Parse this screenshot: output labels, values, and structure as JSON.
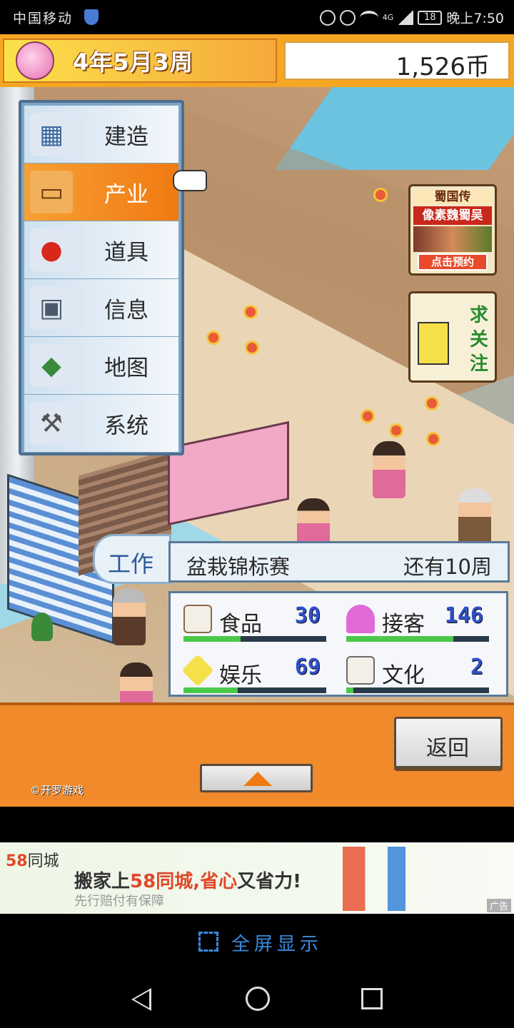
{
  "status_bar": {
    "carrier": "中国移动",
    "network": "4G",
    "battery": "18",
    "time": "晚上7:50"
  },
  "header": {
    "date": "4年5月3周",
    "money": "1,526币"
  },
  "menu": {
    "items": [
      {
        "label": "建造",
        "icon": "building-icon"
      },
      {
        "label": "产业",
        "icon": "signboard-icon"
      },
      {
        "label": "道具",
        "icon": "fruit-icon"
      },
      {
        "label": "信息",
        "icon": "computer-icon"
      },
      {
        "label": "地图",
        "icon": "map-icon"
      },
      {
        "label": "系统",
        "icon": "tools-icon"
      }
    ],
    "active_index": 1
  },
  "side_ads": {
    "ad1": {
      "line1": "蜀国传",
      "line2": "像素魏蜀吴",
      "cta": "点击预约"
    },
    "ad2": {
      "text": "求关注"
    }
  },
  "job_tab": {
    "label": "工作"
  },
  "event": {
    "name": "盆栽锦标赛",
    "remaining": "还有10周"
  },
  "stats": [
    {
      "name": "食品",
      "value": "30",
      "fill": 0.4,
      "icon": "rice-ball-icon"
    },
    {
      "name": "接客",
      "value": "146",
      "fill": 0.75,
      "icon": "heart-icon"
    },
    {
      "name": "娱乐",
      "value": "69",
      "fill": 0.38,
      "icon": "sparkle-icon"
    },
    {
      "name": "文化",
      "value": "2",
      "fill": 0.05,
      "icon": "book-icon"
    }
  ],
  "bottom": {
    "back_label": "返回",
    "copyright": "©开罗游戏"
  },
  "banner": {
    "logo_num": "58",
    "logo_text": "同城",
    "headline_pre": "搬家上",
    "headline_hl": "58同城,省心",
    "headline_post": "又省力!",
    "sub": "先行赔付有保障",
    "ad_tag": "广告"
  },
  "fullscreen": {
    "label": "全屏显示"
  },
  "colors": {
    "accent_orange": "#f07a12",
    "menu_blue": "#7ea6c6",
    "stat_value": "#3050c8"
  }
}
